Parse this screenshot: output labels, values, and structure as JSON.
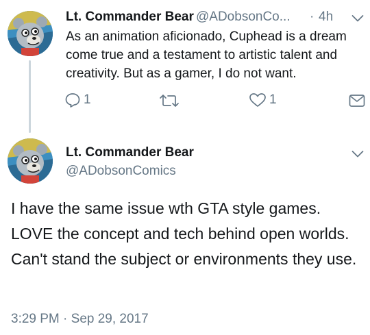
{
  "tweets": [
    {
      "author_name": "Lt. Commander Bear",
      "handle": "@ADobsonCo...",
      "separator": "·",
      "time": "4h",
      "text": "As an animation aficionado, Cuphead is a dream come true and a testament to artistic talent and creativity. But as a gamer, I do not want.",
      "actions": {
        "reply_count": "1",
        "retweet_count": "",
        "like_count": "1"
      }
    },
    {
      "author_name": "Lt. Commander Bear",
      "handle": "@ADobsonComics",
      "text": "I have the same issue wth GTA style games. LOVE the concept and tech behind open worlds. Can't stand the subject or environments they use.",
      "timestamp": "3:29 PM · Sep 29, 2017"
    }
  ],
  "icons": [
    "avatar",
    "chevron-down-icon",
    "reply-icon",
    "retweet-icon",
    "like-icon",
    "direct-message-icon"
  ],
  "colors": {
    "text_primary": "#14171a",
    "text_secondary": "#657786",
    "thread_line": "#ccd6dd"
  }
}
